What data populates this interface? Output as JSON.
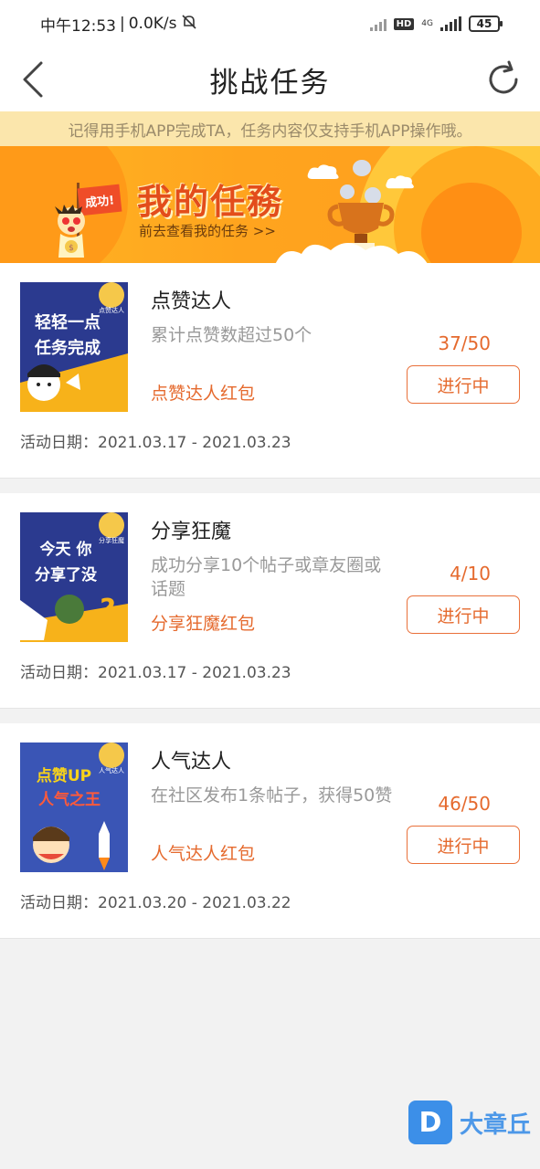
{
  "status_bar": {
    "time": "中午12:53",
    "speed": "0.0K/s",
    "hd": "HD",
    "network": "4G",
    "battery": "45"
  },
  "nav": {
    "title": "挑战任务",
    "back_icon": "chevron-left-icon",
    "refresh_icon": "refresh-icon"
  },
  "notice": "记得用手机APP完成TA，任务内容仅支持手机APP操作哦。",
  "banner": {
    "title": "我的任務",
    "link": "前去查看我的任务 >>",
    "flag_text": "成功!"
  },
  "tasks": [
    {
      "title": "点赞达人",
      "desc": "累计点赞数超过50个",
      "reward": "点赞达人红包",
      "progress": "37/50",
      "button": "进行中",
      "date": "活动日期：2021.03.17 - 2021.03.23",
      "thumb_line1": "轻轻一点",
      "thumb_line2": "任务完成",
      "badge": "点赞达人",
      "thumb_bg": "#2b3a8f"
    },
    {
      "title": "分享狂魔",
      "desc": "成功分享10个帖子或章友圈或话题",
      "reward": "分享狂魔红包",
      "progress": "4/10",
      "button": "进行中",
      "date": "活动日期：2021.03.17 - 2021.03.23",
      "thumb_line1": "今天 你",
      "thumb_line2": "分享了没",
      "badge": "分享狂魔",
      "thumb_bg": "#2b3a8f"
    },
    {
      "title": "人气达人",
      "desc": "在社区发布1条帖子，获得50赞",
      "reward": "人气达人红包",
      "progress": "46/50",
      "button": "进行中",
      "date": "活动日期：2021.03.20 - 2021.03.22",
      "thumb_line1": "点赞UP",
      "thumb_line2": "人气之王",
      "badge": "人气达人",
      "thumb_bg": "#3a55b5"
    }
  ],
  "watermark": {
    "logo": "D",
    "text": "大章丘"
  },
  "colors": {
    "accent": "#e56a2e",
    "notice_bg": "#fbe6ac",
    "banner_bg": "#ffa41e"
  }
}
